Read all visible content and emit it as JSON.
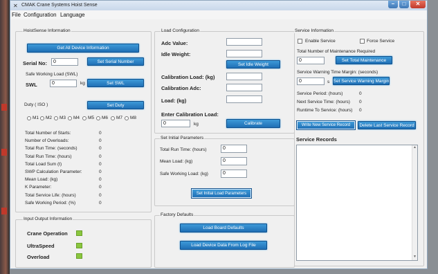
{
  "window": {
    "title": "CMAK Crane Systems Hoist Sense"
  },
  "menu": [
    "File",
    "Configuration",
    "Language"
  ],
  "hoistsense": {
    "title": "HoistSense Information",
    "get_all_btn": "Get All Device Information",
    "serial_label": "Serial No:",
    "serial_value": "0",
    "set_serial_btn": "Set Serial Number",
    "swl_caption": "Safe Working Load (SWL)",
    "swl_label": "SWL",
    "swl_value": "0",
    "swl_unit": "kg",
    "set_swl_btn": "Set SWL",
    "duty_label": "Duty ( ISO )",
    "set_duty_btn": "Set Duty",
    "duty_options": [
      "M1",
      "M2",
      "M3",
      "M4",
      "M5",
      "M6",
      "M7",
      "M8"
    ],
    "stats": [
      {
        "label": "Total Number of Starts:",
        "value": "0"
      },
      {
        "label": "Number of Overloads:",
        "value": "0"
      },
      {
        "label": "Total Run Time: (seconds)",
        "value": "0"
      },
      {
        "label": "Total Run Time: (hours)",
        "value": "0"
      },
      {
        "label": "Total Load Sum (t)",
        "value": "0"
      },
      {
        "label": "SWP Calculation Parameter:",
        "value": "0"
      },
      {
        "label": "Mean Load: (kg)",
        "value": "0"
      },
      {
        "label": "K Parameter:",
        "value": "0"
      },
      {
        "label": "Total Service Life: (hours)",
        "value": "0"
      },
      {
        "label": "Safe Working Period: (%)",
        "value": "0"
      }
    ]
  },
  "io": {
    "title": "Input Output Information",
    "items": [
      {
        "label": "Crane Operation"
      },
      {
        "label": "UltraSpeed"
      },
      {
        "label": "Overload"
      }
    ]
  },
  "load": {
    "title": "Load Configuration",
    "adc_label": "Adc Value:",
    "idle_label": "Idle Weight:",
    "set_idle_btn": "Set Idle Weight",
    "cal_load_label": "Calibration Load: (kg)",
    "cal_adc_label": "Calibration Adc:",
    "load_label": "Load: (kg)",
    "enter_cal_label": "Enter Calibration Load:",
    "enter_cal_value": "0",
    "enter_cal_unit": "kg",
    "calibrate_btn": "Calibrate"
  },
  "initial": {
    "title": "Set Initial Parameters",
    "run_time_label": "Total Run Time: (hours)",
    "run_time_value": "0",
    "mean_load_label": "Mean Load: (kg)",
    "mean_load_value": "0",
    "swl_label": "Safe Working Load: (kg)",
    "swl_value": "0",
    "set_btn": "Set Initial Load Parameters"
  },
  "factory": {
    "title": "Factory Defaults",
    "load_board_btn": "Load Board Defaults",
    "load_log_btn": "Load Device Data From Log File"
  },
  "service": {
    "title": "Service Information",
    "enable_label": "Enable Service",
    "force_label": "Force Service",
    "maint_label": "Total Number of Maintenance Required",
    "maint_value": "0",
    "set_maint_btn": "Set Total Maintenance",
    "warn_label": "Service Warning Time Margin: (seconds)",
    "warn_value": "0",
    "warn_unit": "s",
    "set_warn_btn": "Set Service Warning Margin",
    "period_label": "Service Period: (hours)",
    "period_value": "0",
    "next_label": "Next Service Time: (hours)",
    "next_value": "0",
    "runtime_label": "Runtime To Service: (hours)",
    "runtime_value": "0",
    "write_btn": "Write New Service Record",
    "delete_btn": "Delete Last Service Record",
    "records_label": "Service Records"
  },
  "colors": {
    "button_blue": "#1f6fb5",
    "led_green": "#8ac63e",
    "close_red": "#d9412f"
  }
}
